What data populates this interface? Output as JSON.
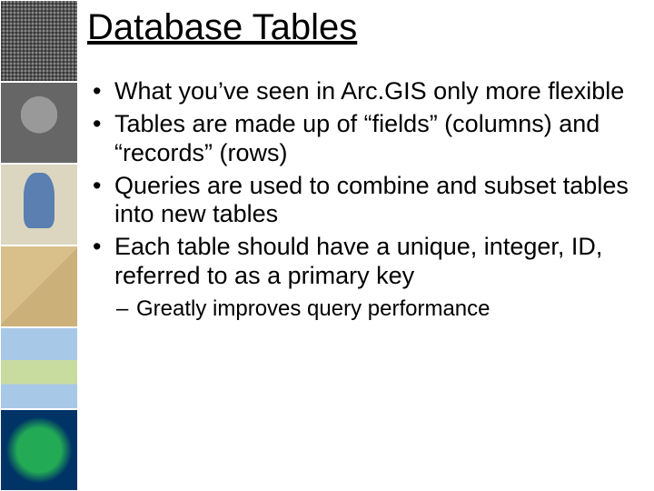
{
  "title": "Database Tables",
  "bullets": [
    "What you’ve seen in Arc.GIS only more flexible",
    "Tables are made up of “fields” (columns) and “records” (rows)",
    "Queries are used to combine and subset tables into new tables",
    "Each table should have a unique, integer, ID, referred to as a primary key"
  ],
  "sub_bullet": "Greatly improves query performance",
  "thumbs": [
    "grid-pattern-map",
    "clay-tablet-map",
    "medieval-map",
    "parchment-map",
    "relief-map",
    "globe-map"
  ]
}
